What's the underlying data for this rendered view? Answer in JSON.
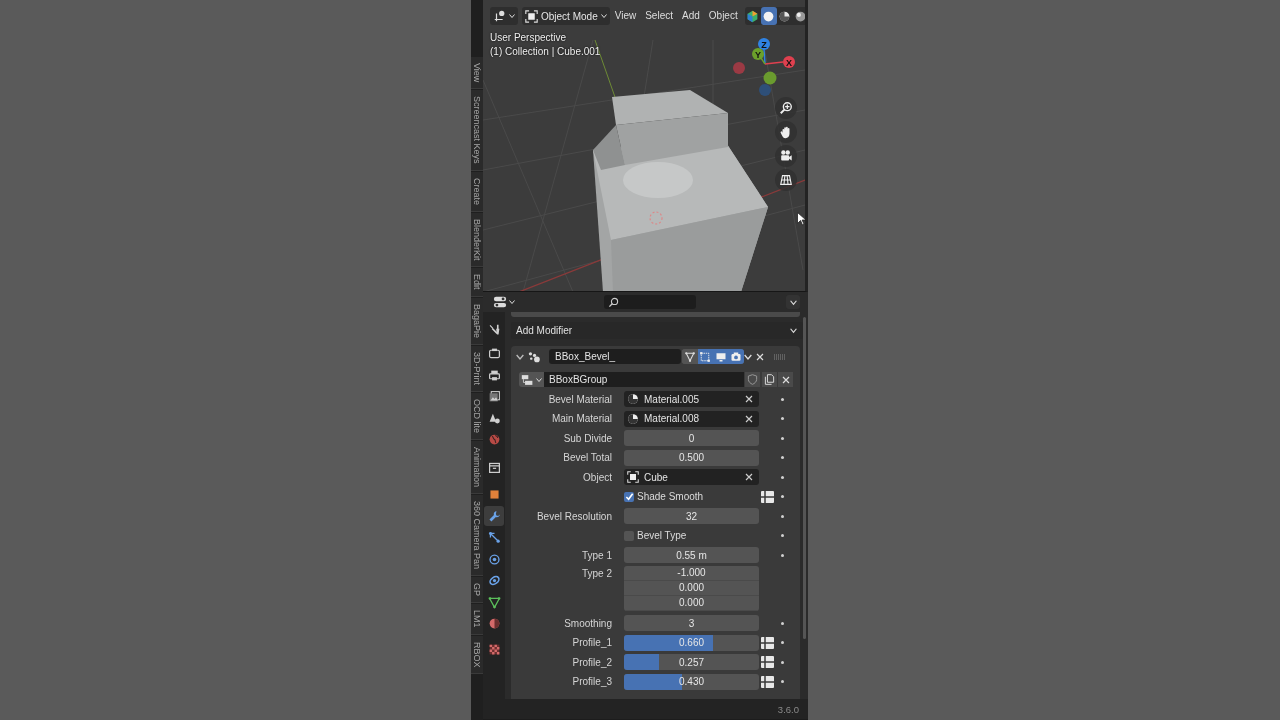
{
  "sidebar_tabs": [
    "View",
    "Screencast Keys",
    "Create",
    "BlenderKit",
    "Edit",
    "BagaPie",
    "3D-Print",
    "OCD lite",
    "Animation",
    "360 Camera Pan",
    "GP",
    "LM1",
    "RBOX"
  ],
  "viewport": {
    "header": {
      "mode": "Object Mode",
      "menus": [
        "View",
        "Select",
        "Add",
        "Object"
      ],
      "shading": [
        {
          "kind": "addon",
          "selected": false
        },
        {
          "kind": "solid",
          "selected": true
        },
        {
          "kind": "material",
          "selected": false
        },
        {
          "kind": "rendered",
          "selected": false
        }
      ]
    },
    "overlay_text": [
      "User Perspective",
      "(1) Collection | Cube.001"
    ],
    "gizmo_labels": {
      "z": "Z",
      "y": "Y",
      "x": "X"
    },
    "nav_buttons": [
      {
        "kind": "zoom"
      },
      {
        "kind": "pan"
      },
      {
        "kind": "camera"
      },
      {
        "kind": "ortho"
      }
    ]
  },
  "properties": {
    "tabs": [
      {
        "kind": "tool",
        "selected": false
      },
      {
        "kind": "render",
        "selected": false
      },
      {
        "kind": "output",
        "selected": false
      },
      {
        "kind": "view_layer",
        "selected": false
      },
      {
        "kind": "scene",
        "selected": false
      },
      {
        "kind": "world",
        "selected": false
      },
      {
        "kind": "collection",
        "selected": false
      },
      {
        "kind": "object",
        "selected": false
      },
      {
        "kind": "modifier",
        "selected": true
      },
      {
        "kind": "particles",
        "selected": false
      },
      {
        "kind": "physics",
        "selected": false
      },
      {
        "kind": "constraints",
        "selected": false
      },
      {
        "kind": "data",
        "selected": false
      },
      {
        "kind": "material",
        "selected": false
      },
      {
        "kind": "texture",
        "selected": false
      }
    ],
    "add_modifier": "Add Modifier",
    "modifier": {
      "expanded": true,
      "name": "BBox_Bevel_",
      "toggles": [
        {
          "kind": "edit_mode",
          "on": false
        },
        {
          "kind": "cage",
          "on": true
        },
        {
          "kind": "viewport",
          "on": true
        },
        {
          "kind": "render",
          "on": true
        }
      ],
      "node_group": "BBoxBGroup",
      "inputs": [
        {
          "label": "Bevel Material",
          "kind": "material",
          "value": "Material.005"
        },
        {
          "label": "Main Material",
          "kind": "material",
          "value": "Material.008"
        },
        {
          "label": "Sub Divide",
          "kind": "number",
          "value": "0"
        },
        {
          "label": "Bevel Total",
          "kind": "number",
          "value": "0.500"
        },
        {
          "label": "Object",
          "kind": "object",
          "value": "Cube"
        },
        {
          "label": "Shade Smooth",
          "kind": "checkbox",
          "checked": true,
          "attribute_toggle": true
        },
        {
          "label": "Bevel Resolution",
          "kind": "number",
          "value": "32"
        },
        {
          "label": "Bevel Type",
          "kind": "checkbox",
          "checked": false
        },
        {
          "label": "Type 1",
          "kind": "number",
          "value": "0.55 m"
        },
        {
          "label": "Type 2",
          "kind": "vector",
          "values": [
            "-1.000",
            "0.000",
            "0.000"
          ]
        },
        {
          "label": "Smoothing",
          "kind": "number",
          "value": "3"
        },
        {
          "label": "Profile_1",
          "kind": "slider",
          "value": "0.660",
          "level": 0.66,
          "attribute_toggle": true
        },
        {
          "label": "Profile_2",
          "kind": "slider",
          "value": "0.257",
          "level": 0.257,
          "attribute_toggle": true
        },
        {
          "label": "Profile_3",
          "kind": "slider",
          "value": "0.430",
          "level": 0.43,
          "attribute_toggle": true
        }
      ]
    }
  },
  "status_bar": {
    "version": "3.6.0"
  }
}
